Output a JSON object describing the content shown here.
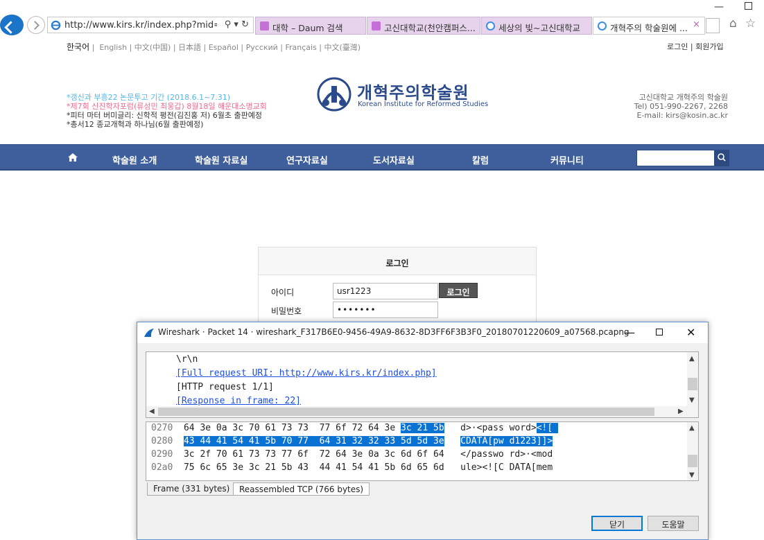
{
  "browser": {
    "url": "http://www.kirs.kr/index.php?mid=home",
    "tabs": [
      {
        "label": "대학 – Daum 검색",
        "color": "#c470d6"
      },
      {
        "label": "고신대학교(천안캠퍼스...",
        "color": "#c470d6"
      },
      {
        "label": "세상의 빛~고신대학교",
        "color": "#3a8ee6"
      },
      {
        "label": "개혁주의 학술원에 ...",
        "color": "#3a8ee6"
      }
    ],
    "tab_close": "×"
  },
  "site": {
    "languages": {
      "current": "한국어",
      "others": "English | 中文(中国) | 日本語 | Español | Русский | Français | 中文(臺灣)"
    },
    "account": {
      "login": "로그인",
      "join": "회원가입"
    },
    "notices": [
      {
        "text": "*갱신과 부흥22 논문투고 기간 (2018.6.1~7.31)",
        "color": "#50b7e6"
      },
      {
        "text": "*제7회 신진학자포럼(류성민 최웅갑) 8월18일 해운대소명교회",
        "color": "#ee6b8e"
      },
      {
        "text": "*피터 마터 버미글리: 신학적 평전(김진홍 저) 6월초 출판예정",
        "color": "#333333"
      },
      {
        "text": "*총서12 종교개혁과 하나님(6월 출판예정)",
        "color": "#333333"
      }
    ],
    "logo": {
      "name": "개혁주의학술원",
      "subtitle": "Korean Institute for Reformed Studies"
    },
    "contact": [
      "고신대학교 개혁주의 학술원",
      "Tel) 051-990-2267, 2268",
      "E-mail: kirs@kosin.ac.kr"
    ],
    "menu": [
      "학술원 소개",
      "학술원 자료실",
      "연구자료실",
      "도서자료실",
      "칼럼",
      "커뮤니티"
    ],
    "search_value": ""
  },
  "login": {
    "title": "로그인",
    "id_label": "아이디",
    "pw_label": "비밀번호",
    "id_value": "usr1223",
    "pw_mask": "•••••••",
    "button": "로그인"
  },
  "wireshark": {
    "title": "Wireshark · Packet 14 · wireshark_F317B6E0-9456-49A9-8632-8D3FF6F3B3F0_20180701220609_a07568.pcapng",
    "tree_lines": [
      {
        "text": "\\r\\n",
        "link": false
      },
      {
        "text": "[Full request URI: http://www.kirs.kr/index.php]",
        "link": true
      },
      {
        "text": "[HTTP request 1/1]",
        "link": false
      },
      {
        "text": "[Response in frame: 22]",
        "link": true
      }
    ],
    "hex_rows": [
      {
        "offset": "0270",
        "hex_plain": "64 3e 0a 3c 70 61 73 73  77 6f 72 64 3e ",
        "hex_sel": "3c 21 5b",
        "ascii_plain": "d>·<pass word>",
        "ascii_sel": "<![ "
      },
      {
        "offset": "0280",
        "hex_plain": "",
        "hex_sel": "43 44 41 54 41 5b 70 77  64 31 32 32 33 5d 5d 3e",
        "ascii_plain": "",
        "ascii_sel": "CDATA[pw d1223]]>"
      },
      {
        "offset": "0290",
        "hex_plain": "3c 2f 70 61 73 73 77 6f  72 64 3e 0a 3c 6d 6f 64",
        "hex_sel": "",
        "ascii_plain": "</passwo rd>·<mod",
        "ascii_sel": ""
      },
      {
        "offset": "02a0",
        "hex_plain": "75 6c 65 3e 3c 21 5b 43  44 41 54 41 5b 6d 65 6d",
        "hex_sel": "",
        "ascii_plain": "ule><![C DATA[mem",
        "ascii_sel": ""
      }
    ],
    "bottom_tabs": [
      "Frame (331 bytes)",
      "Reassembled TCP (766 bytes)"
    ],
    "buttons": {
      "close": "닫기",
      "help": "도움말"
    }
  }
}
